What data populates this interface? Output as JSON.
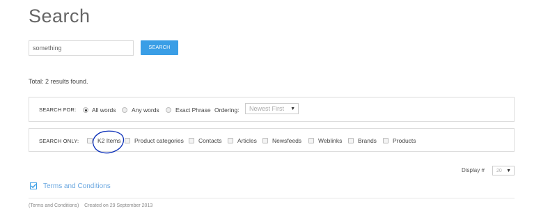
{
  "page": {
    "title": "Search"
  },
  "search": {
    "value": "something",
    "button_label": "SEARCH"
  },
  "total": "Total: 2 results found.",
  "search_for": {
    "label": "SEARCH FOR:",
    "options": [
      "All words",
      "Any words",
      "Exact Phrase"
    ],
    "selected": "All words",
    "ordering_label": "Ordering:",
    "ordering_value": "Newest First"
  },
  "search_only": {
    "label": "SEARCH ONLY:",
    "areas": [
      "K2 Items",
      "Product categories",
      "Contacts",
      "Articles",
      "Newsfeeds",
      "Weblinks",
      "Brands",
      "Products"
    ]
  },
  "display": {
    "label": "Display #",
    "value": "20"
  },
  "results": [
    {
      "title": "Terms and Conditions",
      "category": "(Terms and Conditions)",
      "created": "Created on 29 September 2013"
    }
  ],
  "colors": {
    "accent": "#3a9ee6",
    "annotation": "#0b2fb8",
    "link": "#6aa7e0"
  },
  "icons": {
    "result": "check-square-icon",
    "dropdown": "triangle-down-icon"
  }
}
